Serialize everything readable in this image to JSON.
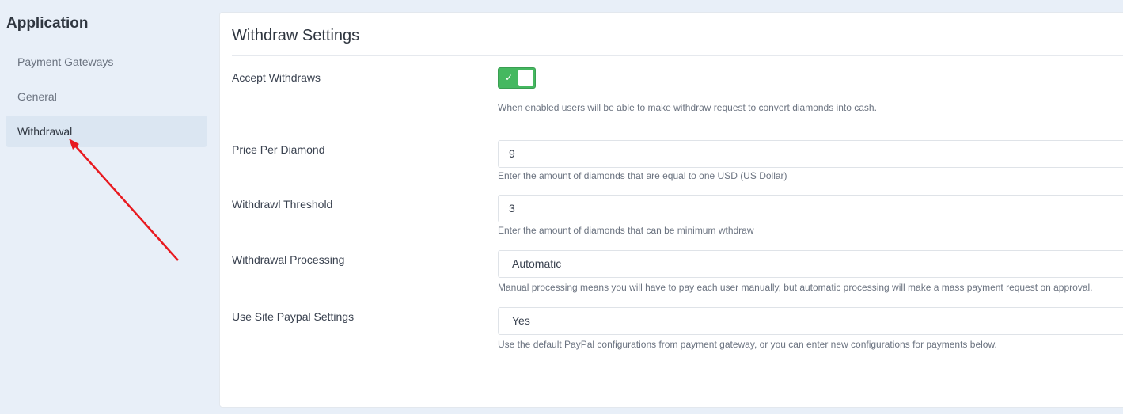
{
  "sidebar": {
    "title": "Application",
    "items": [
      {
        "label": "Payment Gateways"
      },
      {
        "label": "General"
      },
      {
        "label": "Withdrawal"
      }
    ]
  },
  "panel": {
    "title": "Withdraw Settings",
    "accept": {
      "label": "Accept Withdraws",
      "enabled": true,
      "check_glyph": "✓",
      "help": "When enabled users will be able to make withdraw request to convert diamonds into cash."
    },
    "price": {
      "label": "Price Per Diamond",
      "value": "9",
      "help": "Enter the amount of diamonds that are equal to one USD (US Dollar)"
    },
    "threshold": {
      "label": "Withdrawl Threshold",
      "value": "3",
      "help": "Enter the amount of diamonds that can be minimum wthdraw"
    },
    "processing": {
      "label": "Withdrawal Processing",
      "value": "Automatic",
      "help": "Manual processing means you will have to pay each user manually, but automatic processing will make a mass payment request on approval."
    },
    "paypal": {
      "label": "Use Site Paypal Settings",
      "value": "Yes",
      "help": "Use the default PayPal configurations from payment gateway, or you can enter new configurations for payments below."
    }
  },
  "colors": {
    "toggle_on": "#45b860",
    "annotation_arrow": "#e8191f",
    "background": "#e8eff8"
  }
}
